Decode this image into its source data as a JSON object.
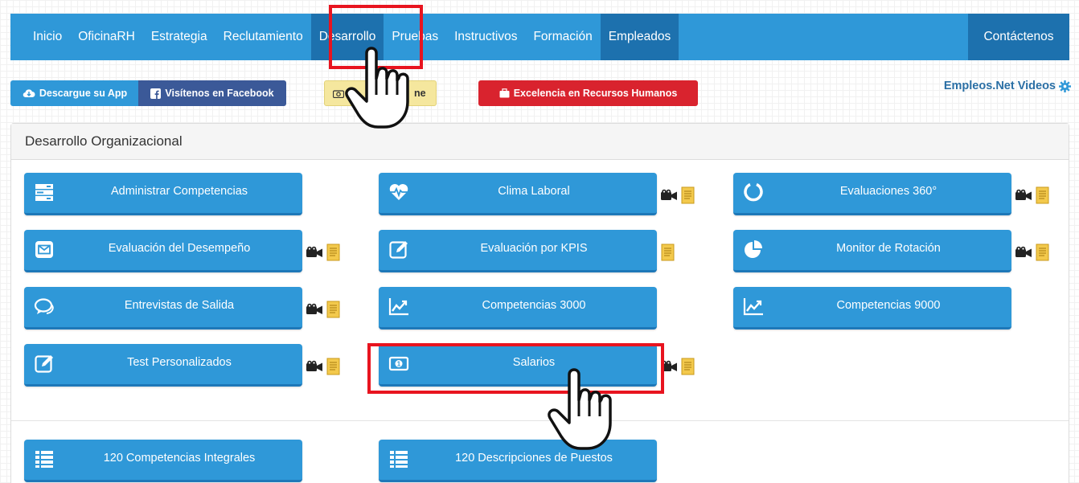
{
  "nav": {
    "items": [
      "Inicio",
      "OficinaRH",
      "Estrategia",
      "Reclutamiento",
      "Desarrollo",
      "Pruebas",
      "Instructivos",
      "Formación",
      "Empleados"
    ],
    "contact": "Contáctenos"
  },
  "toolbar": {
    "app": "Descargue su App",
    "facebook": "Visítenos en Facebook",
    "online": "ne",
    "excellence": "Excelencia en Recursos Humanos",
    "videos": "Empleos.Net Videos"
  },
  "panel": {
    "title": "Desarrollo Organizacional"
  },
  "cards": [
    {
      "label": "Administrar Competencias",
      "icon": "server-icon"
    },
    {
      "label": "Clima Laboral",
      "icon": "heartbeat-icon"
    },
    {
      "label": "Evaluaciones 360°",
      "icon": "circle-notch-icon"
    },
    {
      "label": "Evaluación del Desempeño",
      "icon": "envelope-icon"
    },
    {
      "label": "Evaluación por KPIS",
      "icon": "edit-icon"
    },
    {
      "label": "Monitor de Rotación",
      "icon": "pie-chart-icon"
    },
    {
      "label": "Entrevistas de Salida",
      "icon": "comments-icon"
    },
    {
      "label": "Competencias 3000",
      "icon": "line-chart-icon"
    },
    {
      "label": "Competencias 9000",
      "icon": "line-chart-icon"
    },
    {
      "label": "Test Personalizados",
      "icon": "edit-icon"
    },
    {
      "label": "Salarios",
      "icon": "money-icon"
    },
    {
      "label": "120 Competencias Integrales",
      "icon": "list-icon"
    },
    {
      "label": "120 Descripciones de Puestos",
      "icon": "list-icon"
    }
  ],
  "colors": {
    "brand_blue": "#2f98d8",
    "active_blue": "#1d71ae",
    "facebook": "#3b5998",
    "excellence_red": "#d9232e",
    "highlight_red": "#e8141f"
  }
}
